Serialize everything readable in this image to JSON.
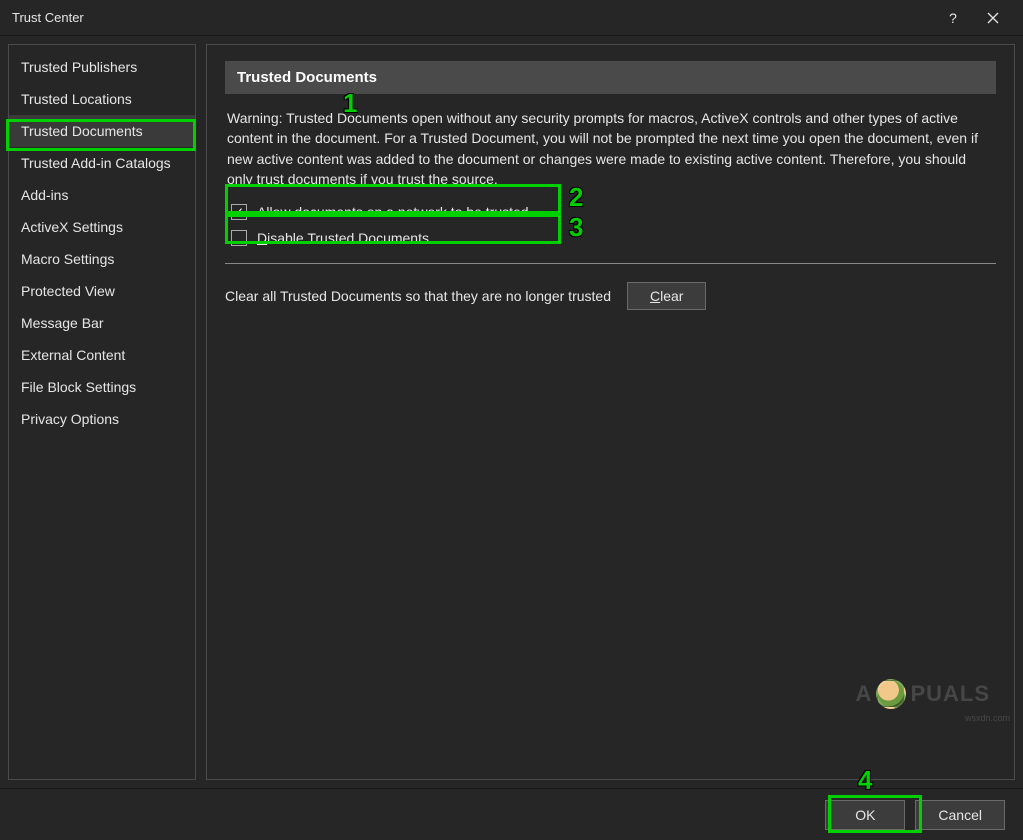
{
  "window": {
    "title": "Trust Center",
    "help_tooltip": "?",
    "close_tooltip": "Close"
  },
  "sidebar": {
    "items": [
      {
        "label": "Trusted Publishers"
      },
      {
        "label": "Trusted Locations"
      },
      {
        "label": "Trusted Documents",
        "selected": true
      },
      {
        "label": "Trusted Add-in Catalogs"
      },
      {
        "label": "Add-ins"
      },
      {
        "label": "ActiveX Settings"
      },
      {
        "label": "Macro Settings"
      },
      {
        "label": "Protected View"
      },
      {
        "label": "Message Bar"
      },
      {
        "label": "External Content"
      },
      {
        "label": "File Block Settings"
      },
      {
        "label": "Privacy Options"
      }
    ]
  },
  "main": {
    "section_title": "Trusted Documents",
    "warning_text": "Warning: Trusted Documents open without any security prompts for macros, ActiveX controls and other types of active content in the document.  For a Trusted Document, you will not be prompted the next time you open the document, even if new active content was added to the document or changes were made to existing active content. Therefore, you should only trust documents if you trust the source.",
    "option_allow": {
      "label": "Allow documents on a network to be trusted",
      "checked": true
    },
    "option_disable": {
      "label": "Disable Trusted Documents",
      "checked": false
    },
    "clear_label": "Clear all Trusted Documents so that they are no longer trusted",
    "clear_button": "Clear"
  },
  "footer": {
    "ok_label": "OK",
    "cancel_label": "Cancel"
  },
  "annotations": {
    "num1": "1",
    "num2": "2",
    "num3": "3",
    "num4": "4"
  },
  "watermark": {
    "pre": "A",
    "post": "PUALS",
    "credit": "wsxdn.com"
  }
}
